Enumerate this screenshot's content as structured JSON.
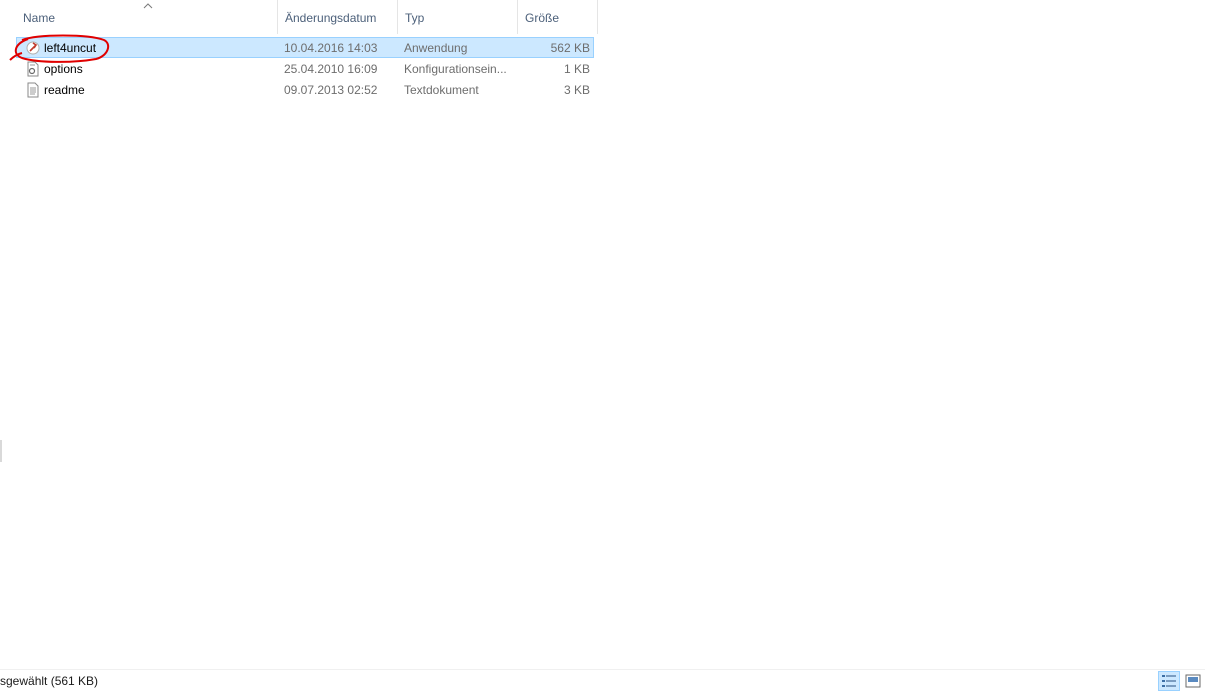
{
  "columns": {
    "name": "Name",
    "date": "Änderungsdatum",
    "type": "Typ",
    "size": "Größe"
  },
  "files": [
    {
      "name": "left4uncut",
      "date": "10.04.2016 14:03",
      "type": "Anwendung",
      "size": "562 KB",
      "icon": "application-icon",
      "selected": true
    },
    {
      "name": "options",
      "date": "25.04.2010 16:09",
      "type": "Konfigurationsein...",
      "size": "1 KB",
      "icon": "config-file-icon",
      "selected": false
    },
    {
      "name": "readme",
      "date": "09.07.2013 02:52",
      "type": "Textdokument",
      "size": "3 KB",
      "icon": "text-file-icon",
      "selected": false
    }
  ],
  "status": {
    "text": "sgewählt (561 KB)"
  },
  "colors": {
    "selection": "#cce8ff",
    "selection_border": "#99d1ff",
    "header_text": "#4c607a",
    "annotation": "#e00000"
  }
}
